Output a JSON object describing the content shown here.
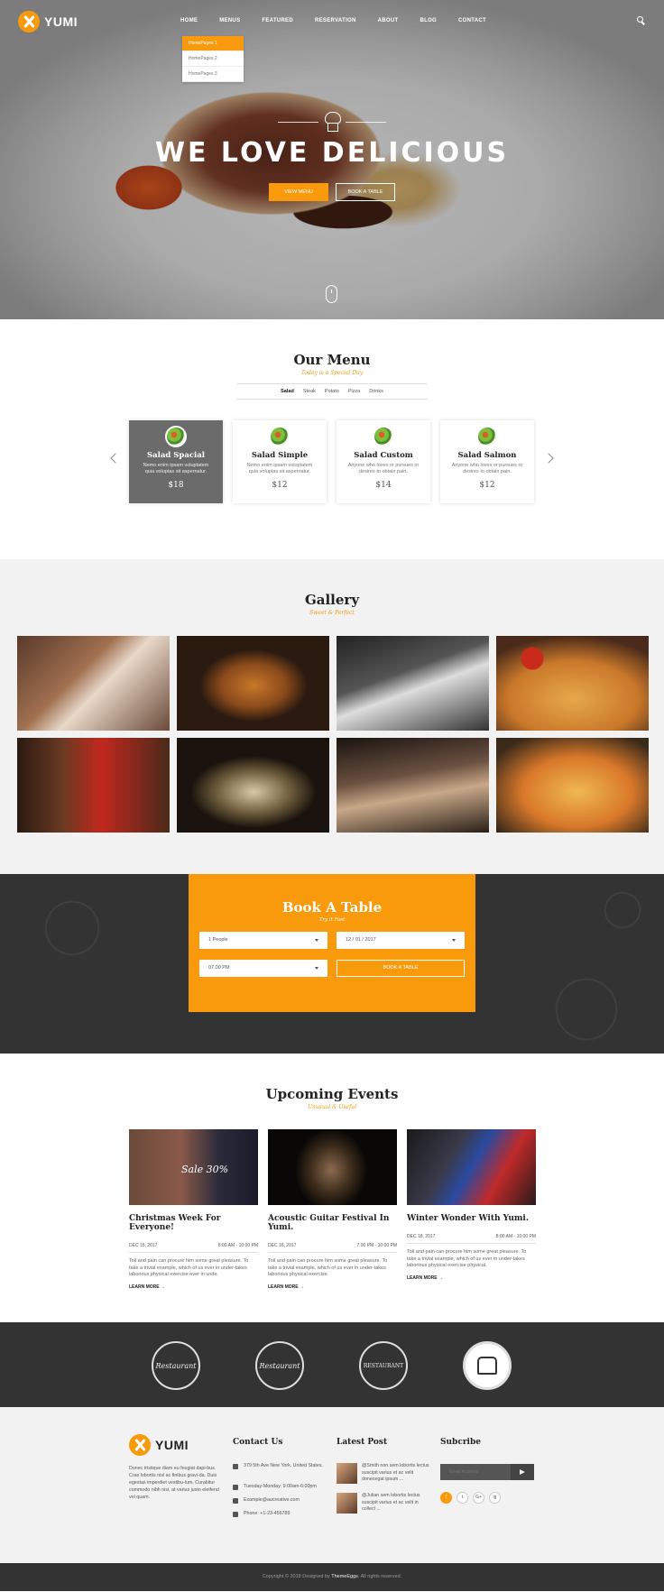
{
  "brand": {
    "name": "YUMI"
  },
  "nav": {
    "items": [
      "HOME",
      "MENUS",
      "FEATURED",
      "RESERVATION",
      "ABOUT",
      "BLOG",
      "CONTACT"
    ]
  },
  "dropdown": {
    "items": [
      "HomePages 1",
      "HomePages 2",
      "HomePages 3"
    ]
  },
  "hero": {
    "title": "WE LOVE DELICIOUS",
    "btn_menu": "VIEW MENU",
    "btn_book": "BOOK A TABLE"
  },
  "our_menu": {
    "title": "Our Menu",
    "subtitle": "Today is a Special Day",
    "tabs": [
      "Salad",
      "Steak",
      "Potato",
      "Pizza",
      "Drinks"
    ],
    "cards": [
      {
        "name": "Salad Spacial",
        "desc": "Nemo enim ipsam voluptatem quia voluptas sit aspernatur.",
        "price": "$18"
      },
      {
        "name": "Salad Simple",
        "desc": "Nemo enim ipsam voluptatem quia voluptas sit aspernatur.",
        "price": "$12"
      },
      {
        "name": "Salad Custom",
        "desc": "Anyone who loves or pursues or desires to obtain pain.",
        "price": "$14"
      },
      {
        "name": "Salad Salmon",
        "desc": "Anyone who loves or pursues or desires to obtain pain.",
        "price": "$12"
      }
    ]
  },
  "gallery": {
    "title": "Gallery",
    "subtitle": "Sweet & Perfect"
  },
  "book": {
    "title": "Book A Table",
    "subtitle": "Try it Fast",
    "people": "1 People",
    "date": "12 / 01 / 2017",
    "time": "07.00 PM",
    "button": "BOOK A TABLE"
  },
  "events": {
    "title": "Upcoming Events",
    "subtitle": "Unusual & Useful",
    "items": [
      {
        "title": "Christmas Week For Everyone!",
        "date": "DEC 15, 2017",
        "time": "8:00 AM - 10:00 PM",
        "desc": "Toil and pain can procure him some great pleasure. To take a trivial example, which of us ever in under-takes laborious physical exercise ever in unde.",
        "more": "LEARN MORE →",
        "img_text": "Sale 30%"
      },
      {
        "title": "Acoustic Guitar Festival In Yumi.",
        "date": "DEC 16, 2017",
        "time": "7:00 PM - 10:00 PM",
        "desc": "Toil and pain can procure him some great pleasure. To take a trivial example, which of us ever in under-takes laborious physical exercise.",
        "more": "LEARN MORE →"
      },
      {
        "title": "Winter Wonder With Yumi.",
        "date": "DEC 18, 2017",
        "time": "8:00 AM - 10:00 PM",
        "desc": "Toil and pain can procure him some great pleasure. To take a trivial example, which of us ever in under-takes laborious physical exercise physical.",
        "more": "LEARN MORE →"
      }
    ]
  },
  "badges": [
    "Restaurant",
    "Restaurant",
    "RESTAURANT",
    ""
  ],
  "footer": {
    "desc": "Donec tristique diam eu feugiat dapi-bus. Cras lobortis nisl ac finibus gravi-da. Duis egestas imperdiet vestibu-lum. Curabitur commodo nibh nisi, at varius justo eleifend vel quam.",
    "contact_title": "Contact Us",
    "address": "379 5th Ave New York, United States.",
    "hours": "Tuesday-Monday: 9:00am-6:00pm",
    "email": "Example@aucreative.com",
    "phone": "Phone: +1-23-456789",
    "latest_title": "Latest Post",
    "posts": [
      {
        "text": "@Smith non sem lobortis lectus suscipit varius et ac velit donecegat ipsum ..."
      },
      {
        "text": "@Julian sem lobortis lectus suscipit varius et ac velit in collect ..."
      }
    ],
    "subscribe_title": "Subcribe",
    "email_placeholder": "Email Address",
    "socials": [
      "f",
      "t",
      "G+",
      "ig"
    ],
    "copyright_pre": "Copyright © 2018 Designed by ",
    "copyright_brand": "ThemeEggs",
    "copyright_post": ". All rights reserved."
  },
  "colors": {
    "accent": "#f99a0c",
    "dark": "#333333",
    "light": "#f2f2f2"
  }
}
